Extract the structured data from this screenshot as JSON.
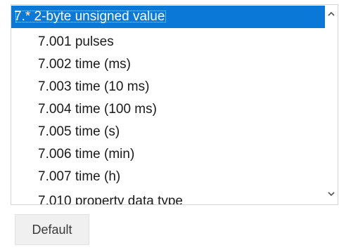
{
  "datatype_list": {
    "items": [
      {
        "label": "7.* 2-byte unsigned value",
        "kind": "group",
        "selected": true
      },
      {
        "label": "7.001 pulses",
        "kind": "sub",
        "selected": false
      },
      {
        "label": "7.002 time (ms)",
        "kind": "sub",
        "selected": false
      },
      {
        "label": "7.003 time (10 ms)",
        "kind": "sub",
        "selected": false
      },
      {
        "label": "7.004 time (100 ms)",
        "kind": "sub",
        "selected": false
      },
      {
        "label": "7.005 time (s)",
        "kind": "sub",
        "selected": false
      },
      {
        "label": "7.006 time (min)",
        "kind": "sub",
        "selected": false
      },
      {
        "label": "7.007 time (h)",
        "kind": "sub",
        "selected": false
      },
      {
        "label": "7.010 property data type",
        "kind": "sub",
        "selected": false
      }
    ],
    "scroll_up_icon": "chevron-up-icon",
    "scroll_down_icon": "chevron-down-icon",
    "selection_color": "#0a78d7"
  },
  "default_button": {
    "label": "Default"
  }
}
